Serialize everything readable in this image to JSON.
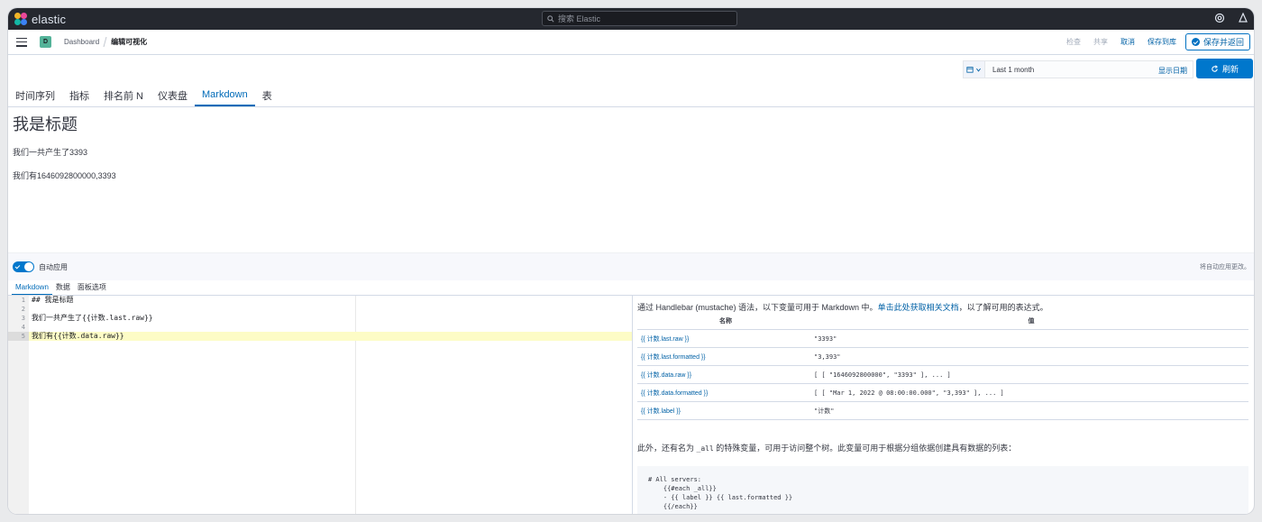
{
  "app": {
    "name": "elastic"
  },
  "search": {
    "placeholder": "搜索 Elastic"
  },
  "breadcrumb": {
    "space": "D",
    "parent": "Dashboard",
    "current": "编辑可视化"
  },
  "actions": {
    "inspect": "检查",
    "share": "共享",
    "cancel": "取消",
    "save_library": "保存到库",
    "save_return": "保存并返回"
  },
  "time": {
    "value": "Last 1 month",
    "show_dates": "显示日期",
    "refresh": "刷新"
  },
  "vis_tabs": [
    {
      "label": "时间序列"
    },
    {
      "label": "指标"
    },
    {
      "label": "排名前 N"
    },
    {
      "label": "仪表盘"
    },
    {
      "label": "Markdown"
    },
    {
      "label": "表"
    }
  ],
  "preview": {
    "heading": "我是标题",
    "line1": "我们一共产生了3393",
    "line2": "我们有1646092800000,3393"
  },
  "auto_apply": {
    "label": "自动应用",
    "note": "将自动应用更改。"
  },
  "editor_tabs": [
    {
      "label": "Markdown"
    },
    {
      "label": "数据"
    },
    {
      "label": "面板选项"
    }
  ],
  "editor_lines": [
    {
      "num": "1",
      "text": "## 我是标题"
    },
    {
      "num": "2",
      "text": ""
    },
    {
      "num": "3",
      "text": "我们一共产生了{{计数.last.raw}}"
    },
    {
      "num": "4",
      "text": ""
    },
    {
      "num": "5",
      "text": "我们有{{计数.data.raw}}"
    }
  ],
  "help": {
    "intro_before": "通过 Handlebar (mustache) 语法，以下变量可用于 Markdown 中。",
    "intro_link": "单击此处获取相关文档",
    "intro_after": "，以了解可用的表达式。",
    "col_name": "名称",
    "col_value": "值",
    "rows": [
      {
        "name": "{{ 计数.last.raw }}",
        "value": "\"3393\""
      },
      {
        "name": "{{ 计数.last.formatted }}",
        "value": "\"3,393\""
      },
      {
        "name": "{{ 计数.data.raw }}",
        "value": "[ [ \"1646092800000\", \"3393\" ], ... ]"
      },
      {
        "name": "{{ 计数.data.formatted }}",
        "value": "[ [ \"Mar 1, 2022 @ 08:00:00.000\", \"3,393\" ], ... ]"
      },
      {
        "name": "{{ 计数.label }}",
        "value": "\"计数\""
      }
    ],
    "extra_before": "此外，还有名为 ",
    "extra_code": "_all",
    "extra_after": " 的特殊变量，可用于访问整个树。此变量可用于根据分组依据创建具有数据的列表：",
    "code_lines": [
      "# All servers:",
      "",
      "    {{#each _all}}",
      "    - {{ label }} {{ last.formatted }}",
      "    {{/each}}"
    ]
  }
}
